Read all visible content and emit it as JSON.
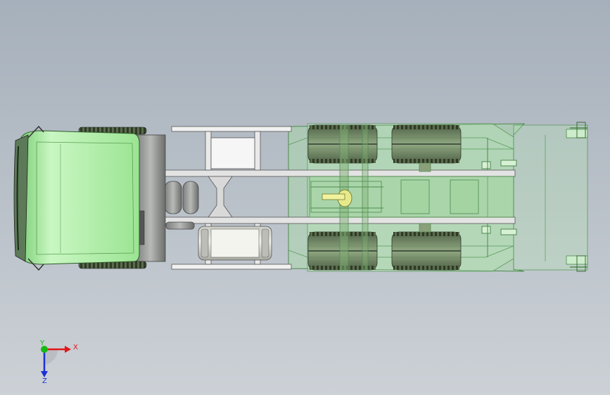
{
  "viewport": {
    "background_top": "#a6b0bb",
    "background_bottom": "#ccd1d6"
  },
  "model": {
    "cab_color": "#a3ec9a",
    "body_color": "#a6dca6",
    "frame_color": "#e2e3e2",
    "tire_color": "#4b5a3e",
    "edge_color": "#2e3a2e"
  },
  "triad": {
    "x_label": "X",
    "y_label": "Y",
    "z_label": "Z",
    "x_color": "#e01818",
    "y_color": "#16b816",
    "z_color": "#1a30d6"
  }
}
